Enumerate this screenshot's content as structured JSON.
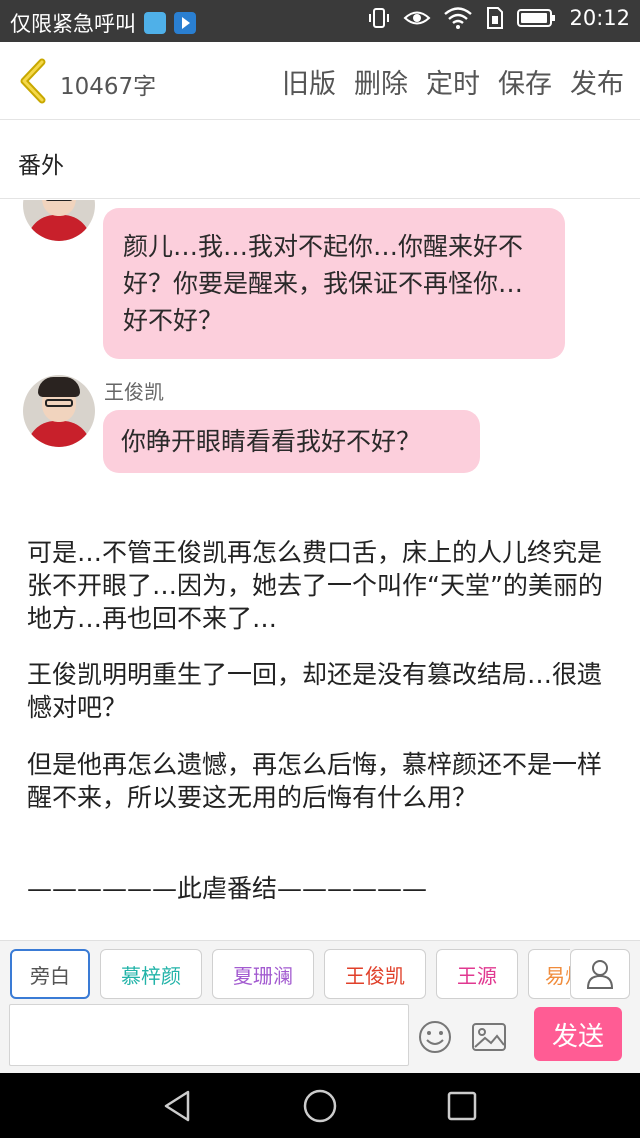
{
  "status_bar": {
    "notification_text": "仅限紧急呼叫",
    "time": "20:12",
    "icons": [
      "qq-app-icon",
      "video-app-icon",
      "vibrate-icon",
      "eye-icon",
      "wifi-icon",
      "sim-icon",
      "battery-icon"
    ]
  },
  "toolbar": {
    "word_count": "10467字",
    "actions": {
      "old_version": "旧版",
      "delete": "删除",
      "timer": "定时",
      "save": "保存",
      "publish": "发布"
    }
  },
  "chapter": {
    "title": "番外"
  },
  "messages": [
    {
      "speaker": "",
      "text": "颜儿…我…我对不起你…你醒来好不好？你要是醒来，我保证不再怪你…好不好？"
    },
    {
      "speaker": "王俊凯",
      "text": "你睁开眼睛看看我好不好？"
    }
  ],
  "narration": [
    "可是…不管王俊凯再怎么费口舌，床上的人儿终究是张不开眼了…因为，她去了一个叫作“天堂”的美丽的地方…再也回不来了…",
    "王俊凯明明重生了一回，却还是没有篡改结局…很遗憾对吧？",
    "但是他再怎么遗憾，再怎么后悔，慕梓颜还不是一样醒不来，所以要这无用的后悔有什么用？",
    "——————此虐番结——————"
  ],
  "roles": [
    {
      "label": "旁白",
      "color": "#555555"
    },
    {
      "label": "慕梓颜",
      "color": "#22b3a8"
    },
    {
      "label": "夏珊澜",
      "color": "#a35bd0"
    },
    {
      "label": "王俊凯",
      "color": "#e0402a"
    },
    {
      "label": "王源",
      "color": "#e03890"
    },
    {
      "label": "易烊千玺",
      "color": "#f08c3c"
    }
  ],
  "composer": {
    "input_value": "",
    "send_label": "发送"
  },
  "colors": {
    "bubble": "#fccfdc",
    "send": "#ff5c94",
    "active_tab": "#3a7bd5"
  }
}
